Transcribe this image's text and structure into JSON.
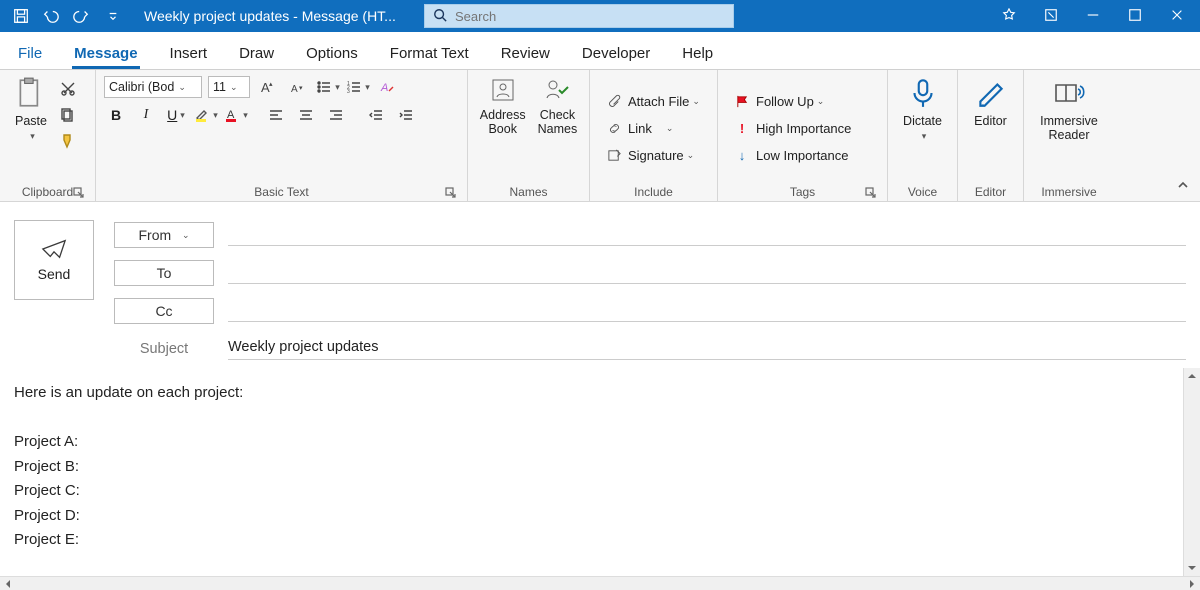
{
  "title": "Weekly project updates - Message (HT...",
  "search_placeholder": "Search",
  "tabs": {
    "file": "File",
    "message": "Message",
    "insert": "Insert",
    "draw": "Draw",
    "options": "Options",
    "format": "Format Text",
    "review": "Review",
    "developer": "Developer",
    "help": "Help"
  },
  "ribbon": {
    "clipboard": {
      "title": "Clipboard",
      "paste": "Paste"
    },
    "basic_text": {
      "title": "Basic Text",
      "font": "Calibri (Bod",
      "size": "11"
    },
    "names": {
      "title": "Names",
      "address": "Address\nBook",
      "check": "Check\nNames"
    },
    "include": {
      "title": "Include",
      "attach": "Attach File",
      "link": "Link",
      "signature": "Signature"
    },
    "tags": {
      "title": "Tags",
      "follow": "Follow Up",
      "high": "High Importance",
      "low": "Low Importance"
    },
    "voice": {
      "title": "Voice",
      "dictate": "Dictate"
    },
    "editor": {
      "title": "Editor",
      "editor": "Editor"
    },
    "immersive": {
      "title": "Immersive",
      "reader": "Immersive\nReader"
    }
  },
  "header": {
    "send": "Send",
    "from": "From",
    "to": "To",
    "cc": "Cc",
    "subject_label": "Subject",
    "subject_value": "Weekly project updates"
  },
  "body": {
    "intro": "Here is an update on each project:",
    "pA": "Project A:",
    "pB": "Project B:",
    "pC": "Project C:",
    "pD": "Project D:",
    "pE": "Project E:"
  }
}
